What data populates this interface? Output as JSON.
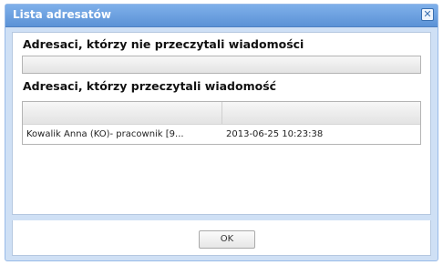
{
  "dialog": {
    "title": "Lista adresatów",
    "close_icon": "close-icon",
    "close_glyph": "✕"
  },
  "unread": {
    "heading": "Adresaci, którzy nie przeczytali wiadomości",
    "rows": []
  },
  "read": {
    "heading": "Adresaci, którzy przeczytali wiadomość",
    "rows": [
      {
        "recipient": "Kowalik Anna (KO)- pracownik [9...",
        "read_at": "2013-06-25 10:23:38"
      }
    ]
  },
  "footer": {
    "ok_label": "OK"
  }
}
